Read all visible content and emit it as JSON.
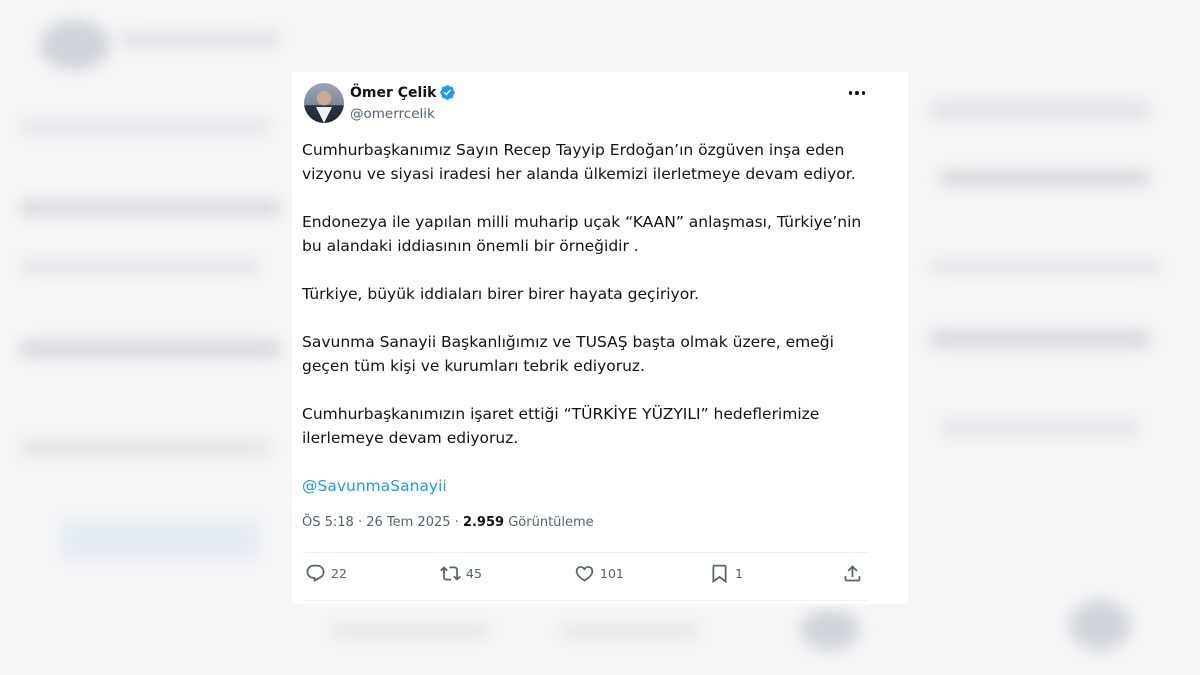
{
  "author": {
    "name": "Ömer Çelik",
    "handle": "@omerrcelik"
  },
  "tweet": {
    "paragraphs": [
      "Cumhurbaşkanımız Sayın Recep Tayyip Erdoğan’ın özgüven inşa eden vizyonu ve siyasi iradesi her alanda ülkemizi ilerletmeye devam ediyor.",
      "Endonezya ile yapılan milli muharip uçak “KAAN” anlaşması, Türkiye’nin bu alandaki iddiasının önemli bir örneğidir .",
      "Türkiye, büyük iddiaları birer birer hayata geçiriyor.",
      "Savunma Sanayii Başkanlığımız ve TUSAŞ başta olmak üzere, emeği geçen tüm kişi ve kurumları tebrik ediyoruz.",
      "Cumhurbaşkanımızın işaret ettiği “TÜRKİYE YÜZYILI” hedeflerimize ilerlemeye devam ediyoruz."
    ],
    "mention": "@SavunmaSanayii",
    "time": "ÖS 5:18",
    "separator": "·",
    "date": "26 Tem 2025",
    "views_count": "2.959",
    "views_label": "Görüntüleme"
  },
  "actions": {
    "replies": "22",
    "reposts": "45",
    "likes": "101",
    "bookmarks": "1"
  },
  "icons": [
    "verified-icon",
    "more-icon",
    "reply-icon",
    "repost-icon",
    "like-icon",
    "bookmark-icon",
    "share-icon"
  ],
  "colors": {
    "accent": "#1d9bf0",
    "text": "#0f1419",
    "muted": "#536471"
  }
}
